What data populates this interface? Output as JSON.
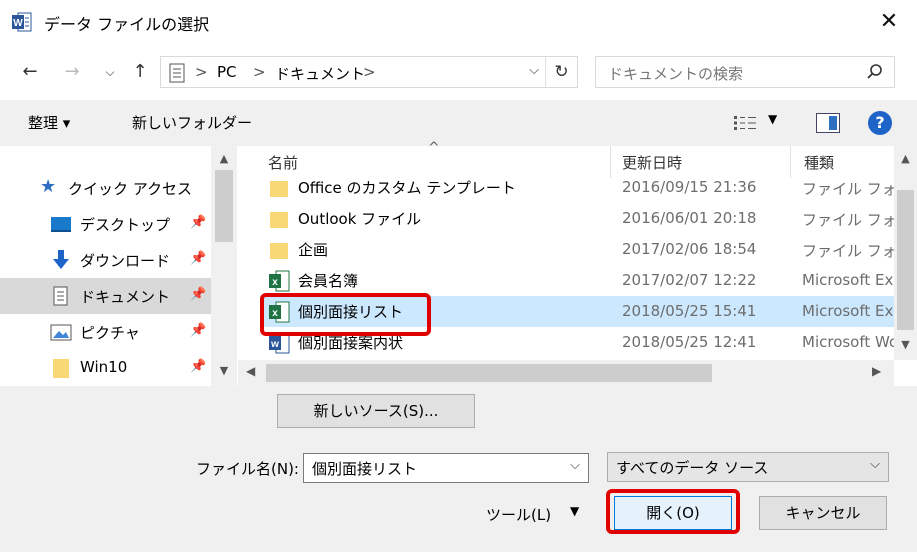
{
  "window": {
    "title": "データ ファイルの選択",
    "close_glyph": "✕"
  },
  "address": {
    "crumbs": [
      "PC",
      "ドキュメント"
    ],
    "separator": ">",
    "search_placeholder": "ドキュメントの検索"
  },
  "toolbar": {
    "organize": "整理 ▾",
    "new_folder": "新しいフォルダー",
    "help": "?"
  },
  "nav": {
    "items": [
      {
        "label": "クイック アクセス"
      },
      {
        "label": "デスクトップ"
      },
      {
        "label": "ダウンロード"
      },
      {
        "label": "ドキュメント"
      },
      {
        "label": "ピクチャ"
      },
      {
        "label": "Win10"
      }
    ]
  },
  "columns": {
    "name": "名前",
    "date": "更新日時",
    "type": "種類"
  },
  "files": [
    {
      "name": "Office のカスタム テンプレート",
      "date": "2016/09/15 21:36",
      "type": "ファイル フォルダー"
    },
    {
      "name": "Outlook ファイル",
      "date": "2016/06/01 20:18",
      "type": "ファイル フォルダー"
    },
    {
      "name": "企画",
      "date": "2017/02/06 18:54",
      "type": "ファイル フォルダー"
    },
    {
      "name": "会員名簿",
      "date": "2017/02/07 12:22",
      "type": "Microsoft Excel"
    },
    {
      "name": "個別面接リスト",
      "date": "2018/05/25 15:41",
      "type": "Microsoft Excel"
    },
    {
      "name": "個別面接案内状",
      "date": "2018/05/25 12:41",
      "type": "Microsoft Word"
    }
  ],
  "bottom": {
    "new_source": "新しいソース(S)...",
    "filename_label": "ファイル名(N):",
    "filename_value": "個別面接リスト",
    "filter_value": "すべてのデータ ソース",
    "tools": "ツール(L)",
    "open": "開く(O)",
    "cancel": "キャンセル"
  },
  "colors": {
    "accent": "#1e63c8",
    "highlight": "#e00000",
    "selection": "#cce8ff"
  }
}
